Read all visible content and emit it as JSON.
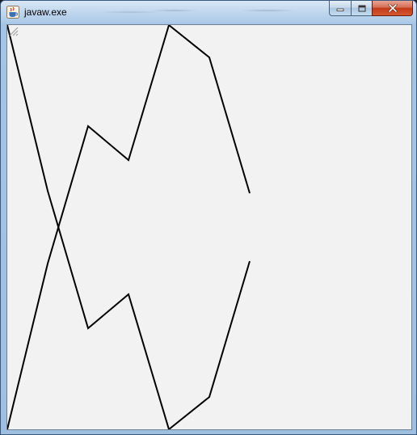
{
  "window": {
    "title": "javaw.exe",
    "app_icon": "java-cup-icon",
    "caption_buttons": [
      "minimize-icon",
      "maximize-icon",
      "close-icon"
    ]
  },
  "canvas": {
    "background": "#f2f2f2",
    "stroke_color": "#000000",
    "polylines": [
      [
        [
          0,
          0
        ],
        [
          50,
          205
        ],
        [
          100,
          375
        ],
        [
          150,
          333
        ],
        [
          200,
          500
        ],
        [
          250,
          460
        ],
        [
          300,
          292
        ]
      ],
      [
        [
          0,
          500
        ],
        [
          50,
          295
        ],
        [
          100,
          125
        ],
        [
          150,
          167
        ],
        [
          200,
          0
        ],
        [
          250,
          40
        ],
        [
          300,
          208
        ]
      ]
    ]
  }
}
